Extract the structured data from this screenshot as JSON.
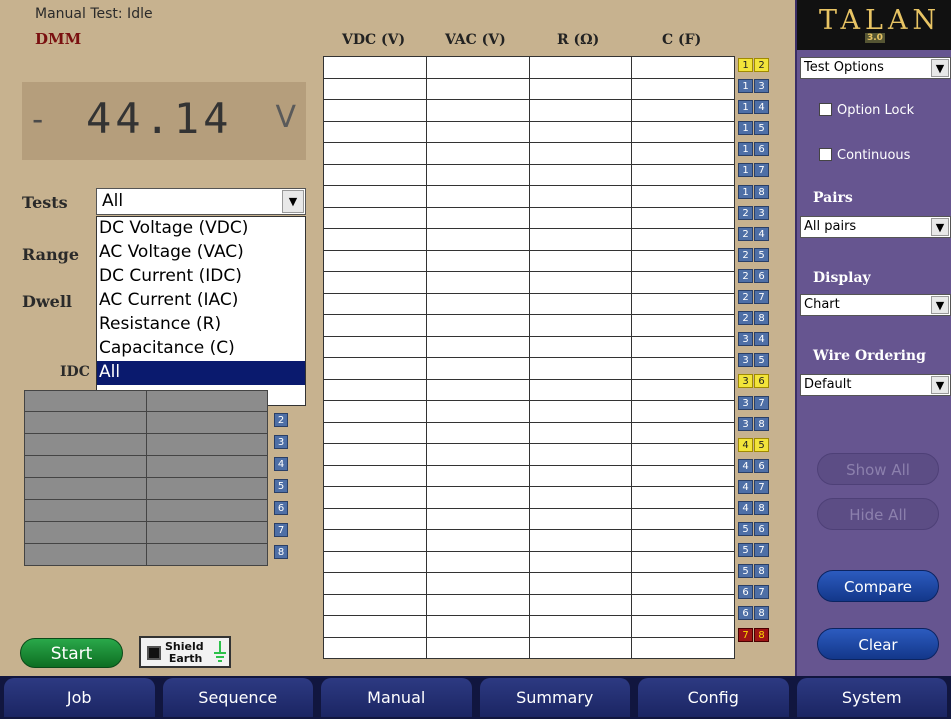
{
  "status": {
    "title": "Manual Test: Idle",
    "mode": "DMM"
  },
  "display": {
    "sign": "-",
    "value": "44.14",
    "unit": "V"
  },
  "tests": {
    "label": "Tests",
    "selected": "All",
    "options": [
      "DC Voltage (VDC)",
      "AC Voltage (VAC)",
      "DC Current (IDC)",
      "AC Current (IAC)",
      "Resistance (R)",
      "Capacitance (C)",
      "All"
    ]
  },
  "labels": {
    "range": "Range",
    "dwell": "Dwell",
    "idc": "IDC"
  },
  "mini_numbers": [
    "2",
    "3",
    "4",
    "5",
    "6",
    "7",
    "8"
  ],
  "columns": [
    "VDC (V)",
    "VAC (V)",
    "R (Ω)",
    "C (F)"
  ],
  "pairs": [
    {
      "a": "1",
      "b": "2",
      "color": "yellow"
    },
    {
      "a": "1",
      "b": "3",
      "color": "blue"
    },
    {
      "a": "1",
      "b": "4",
      "color": "blue"
    },
    {
      "a": "1",
      "b": "5",
      "color": "blue"
    },
    {
      "a": "1",
      "b": "6",
      "color": "blue"
    },
    {
      "a": "1",
      "b": "7",
      "color": "blue"
    },
    {
      "a": "1",
      "b": "8",
      "color": "blue"
    },
    {
      "a": "2",
      "b": "3",
      "color": "blue"
    },
    {
      "a": "2",
      "b": "4",
      "color": "blue"
    },
    {
      "a": "2",
      "b": "5",
      "color": "blue"
    },
    {
      "a": "2",
      "b": "6",
      "color": "blue"
    },
    {
      "a": "2",
      "b": "7",
      "color": "blue"
    },
    {
      "a": "2",
      "b": "8",
      "color": "blue"
    },
    {
      "a": "3",
      "b": "4",
      "color": "blue"
    },
    {
      "a": "3",
      "b": "5",
      "color": "blue"
    },
    {
      "a": "3",
      "b": "6",
      "color": "yellow"
    },
    {
      "a": "3",
      "b": "7",
      "color": "blue"
    },
    {
      "a": "3",
      "b": "8",
      "color": "blue"
    },
    {
      "a": "4",
      "b": "5",
      "color": "yellow"
    },
    {
      "a": "4",
      "b": "6",
      "color": "blue"
    },
    {
      "a": "4",
      "b": "7",
      "color": "blue"
    },
    {
      "a": "4",
      "b": "8",
      "color": "blue"
    },
    {
      "a": "5",
      "b": "6",
      "color": "blue"
    },
    {
      "a": "5",
      "b": "7",
      "color": "blue"
    },
    {
      "a": "5",
      "b": "8",
      "color": "blue"
    },
    {
      "a": "6",
      "b": "7",
      "color": "blue"
    },
    {
      "a": "6",
      "b": "8",
      "color": "blue"
    },
    {
      "a": "7",
      "b": "8",
      "color": "red"
    }
  ],
  "buttons": {
    "start": "Start",
    "shield": "Shield",
    "earth": "Earth"
  },
  "right": {
    "logo": "TALAN",
    "version": "3.0",
    "test_options": "Test Options",
    "option_lock": "Option Lock",
    "continuous": "Continuous",
    "pairs_label": "Pairs",
    "pairs_value": "All pairs",
    "display_label": "Display",
    "display_value": "Chart",
    "wire_label": "Wire Ordering",
    "wire_value": "Default",
    "show_all": "Show All",
    "hide_all": "Hide All",
    "compare": "Compare",
    "clear": "Clear"
  },
  "nav": [
    "Job",
    "Sequence",
    "Manual",
    "Summary",
    "Config",
    "System"
  ]
}
